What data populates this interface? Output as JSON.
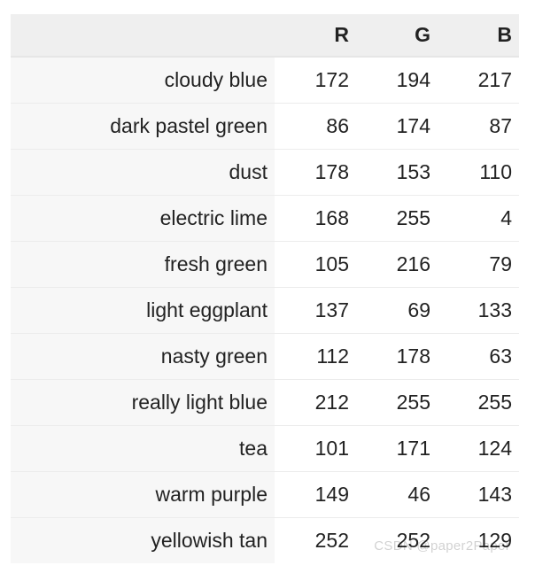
{
  "columns": {
    "name": "",
    "r": "R",
    "g": "G",
    "b": "B"
  },
  "rows": [
    {
      "name": "cloudy blue",
      "r": 172,
      "g": 194,
      "b": 217
    },
    {
      "name": "dark pastel green",
      "r": 86,
      "g": 174,
      "b": 87
    },
    {
      "name": "dust",
      "r": 178,
      "g": 153,
      "b": 110
    },
    {
      "name": "electric lime",
      "r": 168,
      "g": 255,
      "b": 4
    },
    {
      "name": "fresh green",
      "r": 105,
      "g": 216,
      "b": 79
    },
    {
      "name": "light eggplant",
      "r": 137,
      "g": 69,
      "b": 133
    },
    {
      "name": "nasty green",
      "r": 112,
      "g": 178,
      "b": 63
    },
    {
      "name": "really light blue",
      "r": 212,
      "g": 255,
      "b": 255
    },
    {
      "name": "tea",
      "r": 101,
      "g": 171,
      "b": 124
    },
    {
      "name": "warm purple",
      "r": 149,
      "g": 46,
      "b": 143
    },
    {
      "name": "yellowish tan",
      "r": 252,
      "g": 252,
      "b": 129
    }
  ],
  "watermark": "CSDN @paper2Paper"
}
